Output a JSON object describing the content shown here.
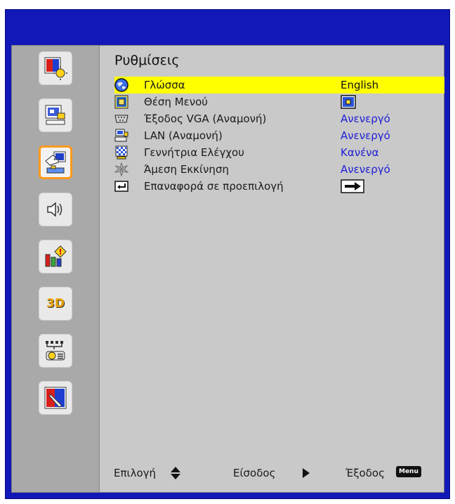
{
  "title": "Ρυθμίσεις",
  "sidebar": {
    "items": [
      {
        "name": "picture-settings",
        "icon": "image-settings-icon",
        "active": false
      },
      {
        "name": "display",
        "icon": "display-icon",
        "active": false
      },
      {
        "name": "setup",
        "icon": "setup-hand-icon",
        "active": true
      },
      {
        "name": "volume",
        "icon": "speaker-icon",
        "active": false
      },
      {
        "name": "options",
        "icon": "options-icon",
        "active": false
      },
      {
        "name": "3d",
        "icon": "3d-icon",
        "label": "3D",
        "active": false
      },
      {
        "name": "network",
        "icon": "network-projector-icon",
        "active": false
      },
      {
        "name": "interactive",
        "icon": "interactive-pen-icon",
        "active": false
      }
    ]
  },
  "rows": [
    {
      "label": "Γλώσσα",
      "value": "English",
      "icon": "globe-icon",
      "selected": true
    },
    {
      "label": "Θέση Μενού",
      "value": "",
      "icon": "menu-position-icon",
      "value_icon": "menu-position-box-icon"
    },
    {
      "label": "Έξοδος VGA (Αναμονή)",
      "value": "Ανενεργό",
      "icon": "vga-port-icon"
    },
    {
      "label": "LAN (Αναμονή)",
      "value": "Ανενεργό",
      "icon": "lan-computer-icon"
    },
    {
      "label": "Γεννήτρια Ελέγχου",
      "value": "Κανένα",
      "icon": "test-pattern-icon"
    },
    {
      "label": "Άμεση Εκκίνηση",
      "value": "Ανενεργό",
      "icon": "direct-power-icon"
    },
    {
      "label": "Επαναφορά σε προεπιλογή",
      "value": "",
      "icon": "reset-icon",
      "value_icon": "enter-arrow-icon"
    }
  ],
  "footer": {
    "select_label": "Επιλογή",
    "enter_label": "Είσοδος",
    "exit_label": "Έξοδος",
    "menu_badge": "Menu"
  },
  "colors": {
    "frame": "#1217b8",
    "highlight": "#ffff00",
    "value_text": "#1c1cd6",
    "active_border": "#ff9a1a"
  }
}
